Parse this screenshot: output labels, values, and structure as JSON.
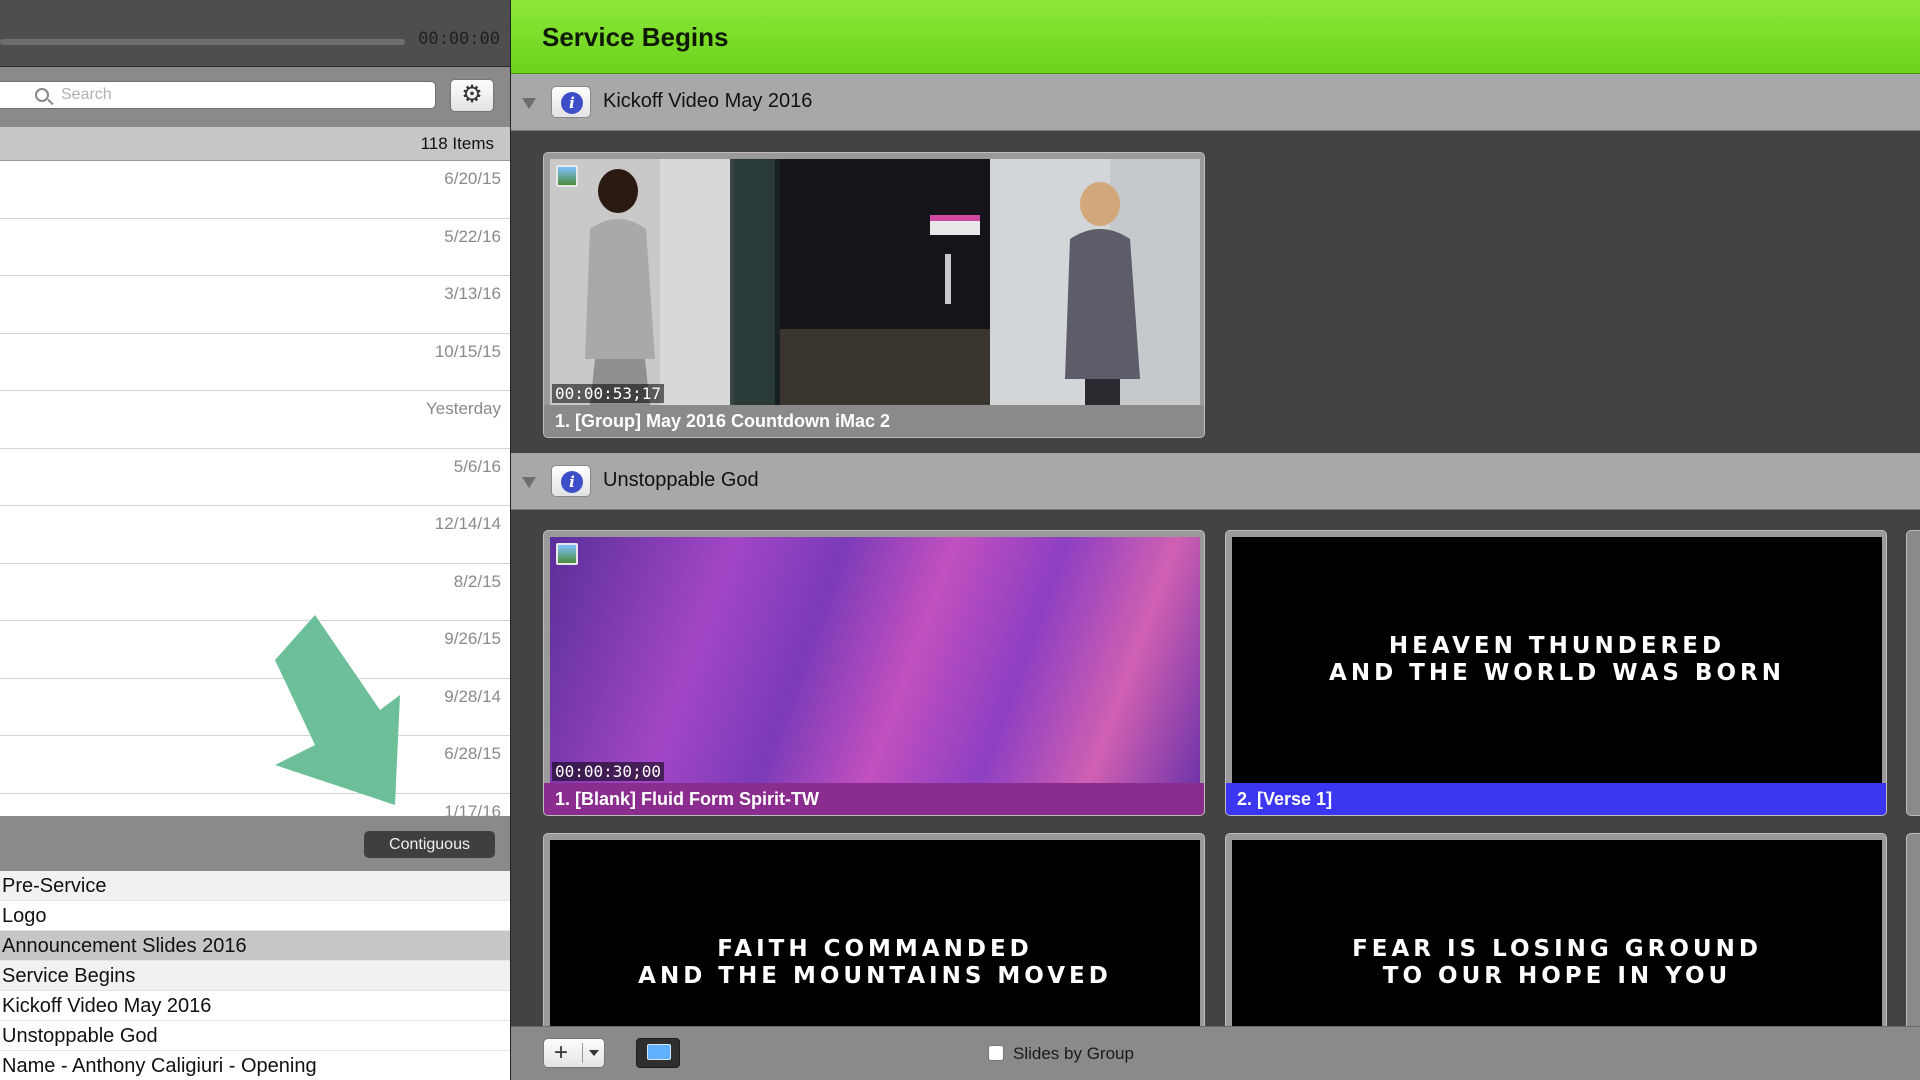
{
  "transport": {
    "timecode": "00:00:00"
  },
  "library": {
    "search_placeholder": "Search",
    "item_count": "118 Items",
    "dates": [
      "6/20/15",
      "5/22/16",
      "3/13/16",
      "10/15/15",
      "Yesterday",
      "5/6/16",
      "12/14/14",
      "8/2/15",
      "9/26/15",
      "9/28/14",
      "6/28/15",
      "1/17/16"
    ]
  },
  "playlist": {
    "mode_button": "Contiguous",
    "items": [
      "Pre-Service",
      "Logo",
      "Announcement Slides 2016",
      "Service Begins",
      "Kickoff Video May 2016",
      "Unstoppable God",
      "Name - Anthony Caligiuri - Opening"
    ]
  },
  "document": {
    "title": "Service Begins",
    "title_color": "#7ddc2b",
    "groups": [
      {
        "name": "Kickoff Video May 2016",
        "slides": [
          {
            "label": "1. [Group] May 2016 Countdown iMac 2",
            "duration": "00:00:53;17"
          }
        ]
      },
      {
        "name": "Unstoppable God",
        "slides": [
          {
            "label": "1. [Blank] Fluid Form Spirit-TW",
            "duration": "00:00:30;00",
            "color": "#8b2d8e"
          },
          {
            "label": "2. [Verse 1]",
            "lyric": "HEAVEN THUNDERED\nAND THE WORLD WAS BORN",
            "color": "#3a36f2"
          },
          {
            "lyric": "FAITH COMMANDED\nAND THE MOUNTAINS MOVED"
          },
          {
            "lyric": "FEAR IS LOSING GROUND\nTO OUR HOPE IN YOU"
          }
        ]
      }
    ]
  },
  "footer": {
    "slides_by_group": "Slides by Group"
  }
}
